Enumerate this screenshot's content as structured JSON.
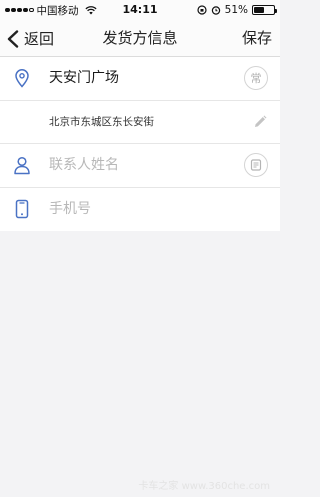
{
  "status_bar": {
    "carrier": "中国移动",
    "time": "14:11",
    "battery_percent_label": "51%",
    "battery_level": 0.51
  },
  "nav": {
    "back_label": "返回",
    "title": "发货方信息",
    "save_label": "保存"
  },
  "form": {
    "address_name": "天安门广场",
    "address_badge": "常",
    "address_detail": "北京市东城区东长安街",
    "contact_placeholder": "联系人姓名",
    "phone_placeholder": "手机号"
  },
  "watermark": "卡车之家 www.360che.com",
  "colors": {
    "accent": "#4a72c4",
    "placeholder": "#b8b8b8",
    "background": "#f3f3f5"
  },
  "icons": {
    "location": "location-pin-icon",
    "person": "person-icon",
    "phone": "phone-icon",
    "edit": "pencil-icon",
    "contacts": "contact-card-icon"
  }
}
